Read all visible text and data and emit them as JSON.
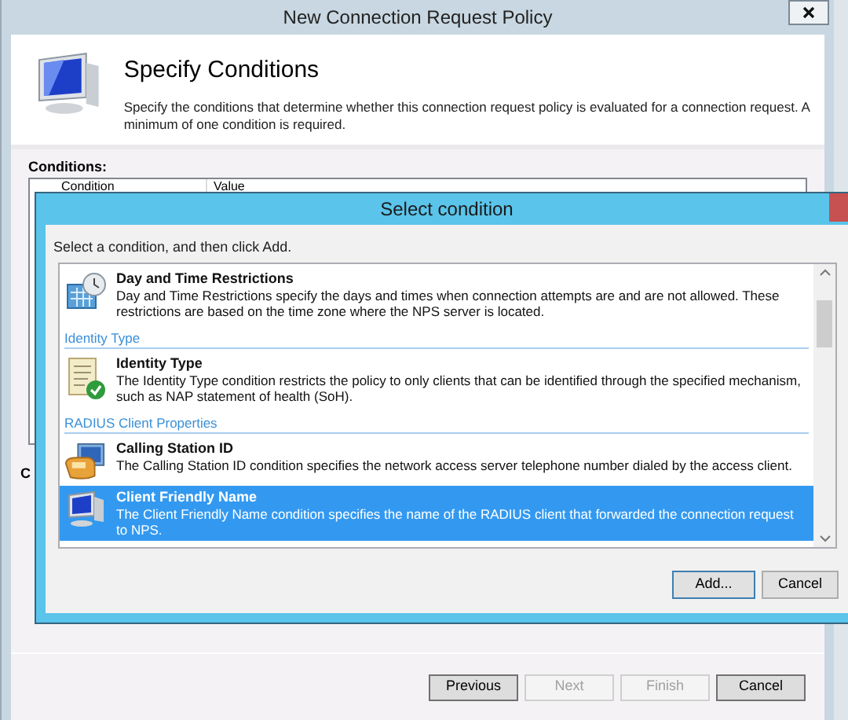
{
  "window": {
    "title": "New Connection Request Policy"
  },
  "header": {
    "title": "Specify Conditions",
    "description": "Specify the conditions that determine whether this connection request policy is evaluated for a connection request. A minimum of one condition is required."
  },
  "conditions": {
    "label": "Conditions:",
    "columns": [
      "Condition",
      "Value"
    ],
    "partial_label": "C"
  },
  "dialog": {
    "title": "Select condition",
    "instruction": "Select a condition, and then click Add.",
    "items": [
      {
        "kind": "condition",
        "title": "Day and Time Restrictions",
        "description": "Day and Time Restrictions specify the days and times when connection attempts are and are not allowed. These restrictions are based on the time zone where the NPS server is located.",
        "selected": false
      },
      {
        "kind": "group",
        "title": "Identity Type"
      },
      {
        "kind": "condition",
        "title": "Identity Type",
        "description": "The Identity Type condition restricts the policy to only clients that can be identified through the specified mechanism, such as NAP statement of health (SoH).",
        "selected": false
      },
      {
        "kind": "group",
        "title": "RADIUS Client Properties"
      },
      {
        "kind": "condition",
        "title": "Calling Station ID",
        "description": "The Calling Station ID condition specifies the network access server telephone number dialed by the access client.",
        "selected": false
      },
      {
        "kind": "condition",
        "title": "Client Friendly Name",
        "description": "The Client Friendly Name condition specifies the name of the RADIUS client that forwarded the connection request to NPS.",
        "selected": true
      }
    ],
    "buttons": [
      "Add...",
      "Cancel"
    ]
  },
  "footer_buttons": [
    {
      "label": "Previous",
      "disabled": false
    },
    {
      "label": "Next",
      "disabled": true
    },
    {
      "label": "Finish",
      "disabled": true
    },
    {
      "label": "Cancel",
      "disabled": false
    }
  ]
}
